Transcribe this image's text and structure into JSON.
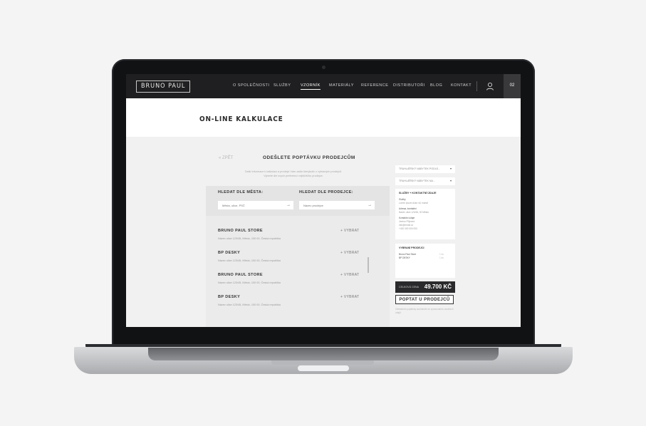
{
  "nav": {
    "logo": "BRUNO PAUL",
    "items": [
      {
        "label": "O SPOLEČNOSTI"
      },
      {
        "label": "SLUŽBY"
      },
      {
        "label": "VZORNÍK"
      },
      {
        "label": "MATERIÁLY"
      },
      {
        "label": "REFERENCE"
      },
      {
        "label": "DISTRIBUTOŘI"
      },
      {
        "label": "BLOG"
      },
      {
        "label": "KONTAKT"
      }
    ],
    "active_index": 2,
    "user_icon": "user-icon",
    "cart_count": "02"
  },
  "page": {
    "title": "ON-LINE KALKULACE",
    "back_label": "« ZPĚT",
    "form_title": "ODEŠLETE POPTÁVKU PRODEJCŮM",
    "form_description": "Další informace k kalkulaci a prodejci Vám zašle kterýkoliv z vybraných prodejců. Vyberte dle svých preferencí nejbližšího prodejce."
  },
  "search": {
    "city_label": "HLEDAT DLE MĚSTA:",
    "city_placeholder": "Město, ulice, PSČ",
    "seller_label": "HLEDAT DLE PRODEJCE:",
    "seller_placeholder": "Název prodejce"
  },
  "sellers": [
    {
      "name": "BRUNO PAUL STORE",
      "address": "Název ulice 123/45, Město, 100 00, Česká republika",
      "action": "+ VYBRAT"
    },
    {
      "name": "BP DESKY",
      "address": "Název ulice 123/45, Město, 100 00, Česká republika",
      "action": "+ VYBRAT"
    },
    {
      "name": "BRUNO PAUL STORE",
      "address": "Název ulice 123/45, Město, 100 00, Česká republika",
      "action": "+ VYBRAT"
    },
    {
      "name": "BP DESKY",
      "address": "Název ulice 123/45, Město, 100 00, Česká republika",
      "action": "+ VYBRAT"
    }
  ],
  "sidebar": {
    "dropdown1": "TRUHLÁŘSKÝ NÁBYTEK PODLE...",
    "dropdown2": "TRUHLÁŘSKÝ NÁBYTEK NA...",
    "contact_title": "SLUŽBY + KONTAKTNÍ ÚDAJE",
    "contact_lines": [
      "Služby",
      "Lorem ipsum dolor sit, mahdi",
      "Adresa, kontaktní",
      "Název ulice 123/45, 00 Město",
      "Kontaktní údaje",
      "Jméno Příjmení",
      "info@email.cz",
      "+420 000 000 000"
    ],
    "sellers_title": "VYBRANÍ PRODEJCI",
    "selected": [
      {
        "name": "Bruno Paul Store",
        "value": "1 ks"
      },
      {
        "name": "BP DESKY",
        "value": "1 ks"
      }
    ],
    "total_label": "CELKOVÁ CENA",
    "total_value": "49.700 KČ",
    "cta_label": "POPTAT U PRODEJCŮ",
    "note": "Odesláním poptávky souhlasíte se zpracováním osobních údajů."
  }
}
